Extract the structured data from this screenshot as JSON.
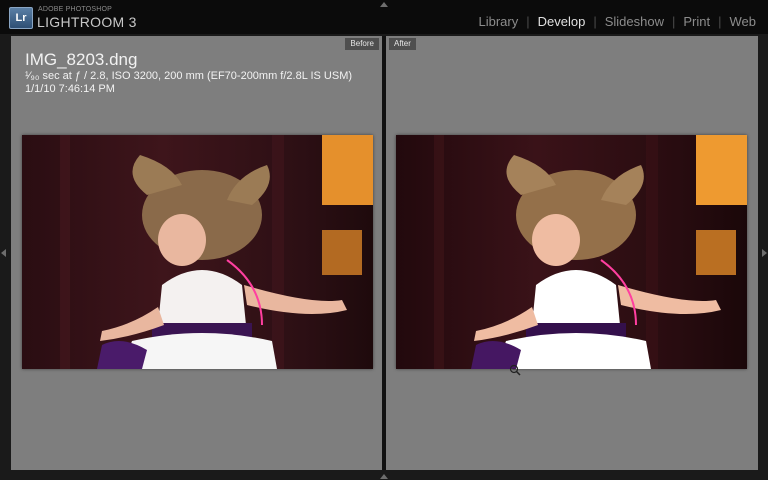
{
  "app": {
    "vendor": "ADOBE PHOTOSHOP",
    "name": "LIGHTROOM 3",
    "logo": "Lr"
  },
  "modules": [
    {
      "label": "Library",
      "active": false
    },
    {
      "label": "Develop",
      "active": true
    },
    {
      "label": "Slideshow",
      "active": false
    },
    {
      "label": "Print",
      "active": false
    },
    {
      "label": "Web",
      "active": false
    }
  ],
  "compare": {
    "before_label": "Before",
    "after_label": "After"
  },
  "photo_info": {
    "filename": "IMG_8203.dng",
    "exposure": "¹⁄₉₀ sec at ƒ / 2.8, ISO 3200, 200 mm (EF70-200mm f/2.8L IS USM)",
    "datetime": "1/1/10 7:46:14 PM"
  },
  "colors": {
    "background": "#1a1a1a",
    "pane": "#7e7e7e",
    "active_module": "#e0e0e0",
    "inactive_module": "#8c8c8c"
  },
  "icons": [
    "lightroom-logo-icon",
    "panel-collapse-arrow-icon",
    "zoom-cursor-icon"
  ]
}
